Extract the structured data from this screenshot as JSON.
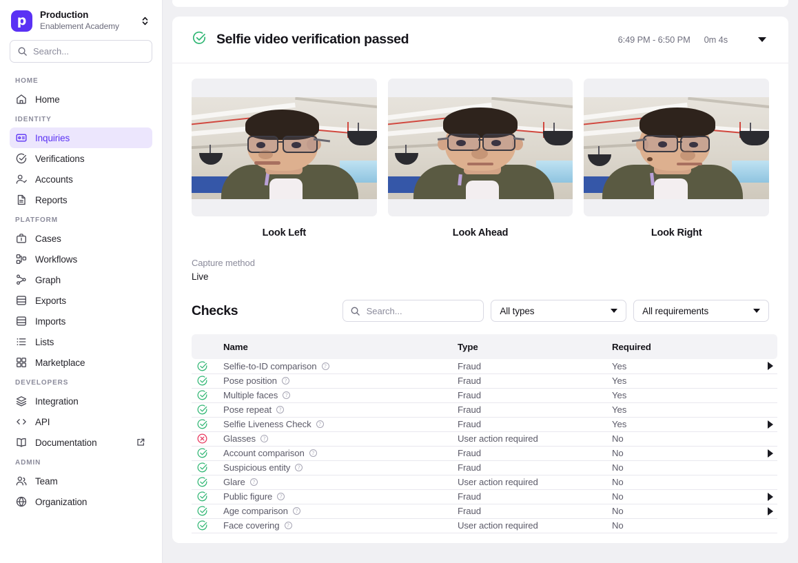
{
  "sidebar": {
    "org": {
      "logo_letter": "p",
      "name": "Production",
      "subtitle": "Enablement Academy",
      "accent": "#5a31f4"
    },
    "search": {
      "placeholder": "Search..."
    },
    "sections": [
      {
        "label": "HOME",
        "items": [
          {
            "label": "Home",
            "icon": "home-icon",
            "active": false
          }
        ]
      },
      {
        "label": "IDENTITY",
        "items": [
          {
            "label": "Inquiries",
            "icon": "id-card-icon",
            "active": true
          },
          {
            "label": "Verifications",
            "icon": "check-circle-icon",
            "active": false
          },
          {
            "label": "Accounts",
            "icon": "user-check-icon",
            "active": false
          },
          {
            "label": "Reports",
            "icon": "document-icon",
            "active": false
          }
        ]
      },
      {
        "label": "PLATFORM",
        "items": [
          {
            "label": "Cases",
            "icon": "briefcase-icon",
            "active": false
          },
          {
            "label": "Workflows",
            "icon": "workflow-icon",
            "active": false
          },
          {
            "label": "Graph",
            "icon": "graph-icon",
            "active": false
          },
          {
            "label": "Exports",
            "icon": "database-icon",
            "active": false
          },
          {
            "label": "Imports",
            "icon": "database-icon",
            "active": false
          },
          {
            "label": "Lists",
            "icon": "list-icon",
            "active": false
          },
          {
            "label": "Marketplace",
            "icon": "grid-icon",
            "active": false
          }
        ]
      },
      {
        "label": "DEVELOPERS",
        "items": [
          {
            "label": "Integration",
            "icon": "layers-icon",
            "active": false
          },
          {
            "label": "API",
            "icon": "code-icon",
            "active": false
          },
          {
            "label": "Documentation",
            "icon": "book-icon",
            "active": false,
            "external": true
          }
        ]
      },
      {
        "label": "ADMIN",
        "items": [
          {
            "label": "Team",
            "icon": "users-icon",
            "active": false
          },
          {
            "label": "Organization",
            "icon": "globe-icon",
            "active": false
          }
        ]
      }
    ]
  },
  "card": {
    "status_icon": "check-circle-icon",
    "status_color": "#2fb673",
    "title": "Selfie video verification passed",
    "time_range": "6:49 PM - 6:50 PM",
    "duration": "0m 4s"
  },
  "photos": [
    {
      "caption": "Look Left",
      "pose": "left"
    },
    {
      "caption": "Look Ahead",
      "pose": "ahead"
    },
    {
      "caption": "Look Right",
      "pose": "right"
    }
  ],
  "capture": {
    "label": "Capture method",
    "value": "Live"
  },
  "checks": {
    "title": "Checks",
    "search_placeholder": "Search...",
    "type_filter": "All types",
    "requirement_filter": "All requirements",
    "columns": [
      "Name",
      "Type",
      "Required"
    ],
    "rows": [
      {
        "status": "pass",
        "name": "Selfie-to-ID comparison",
        "type": "Fraud",
        "required": "Yes",
        "expandable": true
      },
      {
        "status": "pass",
        "name": "Pose position",
        "type": "Fraud",
        "required": "Yes",
        "expandable": false
      },
      {
        "status": "pass",
        "name": "Multiple faces",
        "type": "Fraud",
        "required": "Yes",
        "expandable": false
      },
      {
        "status": "pass",
        "name": "Pose repeat",
        "type": "Fraud",
        "required": "Yes",
        "expandable": false
      },
      {
        "status": "pass",
        "name": "Selfie Liveness Check",
        "type": "Fraud",
        "required": "Yes",
        "expandable": true
      },
      {
        "status": "fail",
        "name": "Glasses",
        "type": "User action required",
        "required": "No",
        "expandable": false
      },
      {
        "status": "pass",
        "name": "Account comparison",
        "type": "Fraud",
        "required": "No",
        "expandable": true
      },
      {
        "status": "pass",
        "name": "Suspicious entity",
        "type": "Fraud",
        "required": "No",
        "expandable": false
      },
      {
        "status": "pass",
        "name": "Glare",
        "type": "User action required",
        "required": "No",
        "expandable": false
      },
      {
        "status": "pass",
        "name": "Public figure",
        "type": "Fraud",
        "required": "No",
        "expandable": true
      },
      {
        "status": "pass",
        "name": "Age comparison",
        "type": "Fraud",
        "required": "No",
        "expandable": true
      },
      {
        "status": "pass",
        "name": "Face covering",
        "type": "User action required",
        "required": "No",
        "expandable": false
      }
    ],
    "status_colors": {
      "pass": "#2fb673",
      "fail": "#e8365d"
    }
  }
}
